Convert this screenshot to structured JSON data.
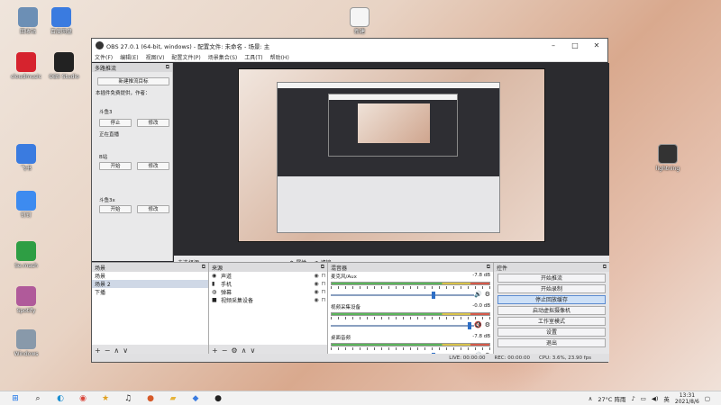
{
  "desktop": {
    "icons_left": [
      {
        "label": "回收站",
        "icon": "recycle-bin-icon",
        "color": "#6c8fb5"
      },
      {
        "label": "百度网盘",
        "icon": "cloud-drive-icon",
        "color": "#3a7be0"
      },
      {
        "label": "cloudmusic",
        "icon": "netease-music-icon",
        "color": "#d6232e"
      },
      {
        "label": "OBS Studio",
        "icon": "obs-icon",
        "color": "#222222"
      },
      {
        "label": "飞书",
        "icon": "feishu-icon",
        "color": "#3a7be0"
      },
      {
        "label": "钉钉",
        "icon": "dingtalk-icon",
        "color": "#3d8bf0"
      },
      {
        "label": "Se.mash",
        "icon": "music-app-icon",
        "color": "#2e9e44"
      },
      {
        "label": "Spotify",
        "icon": "photo-icon",
        "color": "#b05a9a"
      },
      {
        "label": "Windows",
        "icon": "file-icon",
        "color": "#8899aa"
      }
    ],
    "icons_right": [
      {
        "label": "新建",
        "icon": "document-icon",
        "color": "#f5f5f5"
      },
      {
        "label": "lightning",
        "icon": "app-shortcut-icon",
        "color": "#333333"
      }
    ]
  },
  "obs": {
    "title": "OBS 27.0.1 (64-bit, windows) - 配置文件: 未命名 - 场景: 主",
    "menu": [
      "文件(F)",
      "编辑(E)",
      "视图(V)",
      "配置文件(P)",
      "场景集合(S)",
      "工具(T)",
      "帮助(H)"
    ],
    "multiview": {
      "title": "多路推流",
      "new_target_button": "新建推流目标",
      "description": "本插件免费提供，作者：",
      "groups": [
        {
          "name": "斗鱼3",
          "start": "停止",
          "edit": "修改",
          "status": "正在直播"
        },
        {
          "name": "B站",
          "start": "开始",
          "edit": "修改",
          "status": ""
        },
        {
          "name": "斗鱼3x",
          "start": "开始",
          "edit": "修改",
          "status": ""
        }
      ]
    },
    "preview_bar": {
      "source": "未选择源",
      "properties": "属性",
      "filters": "滤镜"
    },
    "scenes": {
      "title": "场景",
      "items": [
        "场景",
        "场景 2",
        "下播"
      ],
      "selected_index": 1
    },
    "sources": {
      "title": "来源",
      "items": [
        "声道",
        "手机",
        "弹幕",
        "视频采集设备"
      ]
    },
    "mixer": {
      "title": "混音器",
      "tracks": [
        {
          "name": "麦克风/Aux",
          "db": "-7.8 dB",
          "level": 0.72,
          "muted": false
        },
        {
          "name": "视频采集设备",
          "db": "-0.0 dB",
          "level": 0.97,
          "muted": true
        },
        {
          "name": "桌面音频",
          "db": "-7.8 dB",
          "level": 0.72,
          "muted": false
        }
      ]
    },
    "controls": {
      "title": "控件",
      "buttons": [
        "开始推流",
        "开始录制",
        "停止回放缓存",
        "启动虚拟摄像机",
        "工作室模式",
        "设置",
        "退出"
      ],
      "active_index": 2
    },
    "status": {
      "live": "LIVE: 00:00:00",
      "rec": "REC: 00:00:00",
      "cpu": "CPU: 3.6%, 23.90 fps"
    }
  },
  "taskbar": {
    "weather": "27°C 阵雨",
    "time": "13:31",
    "date": "2021/8/6"
  }
}
